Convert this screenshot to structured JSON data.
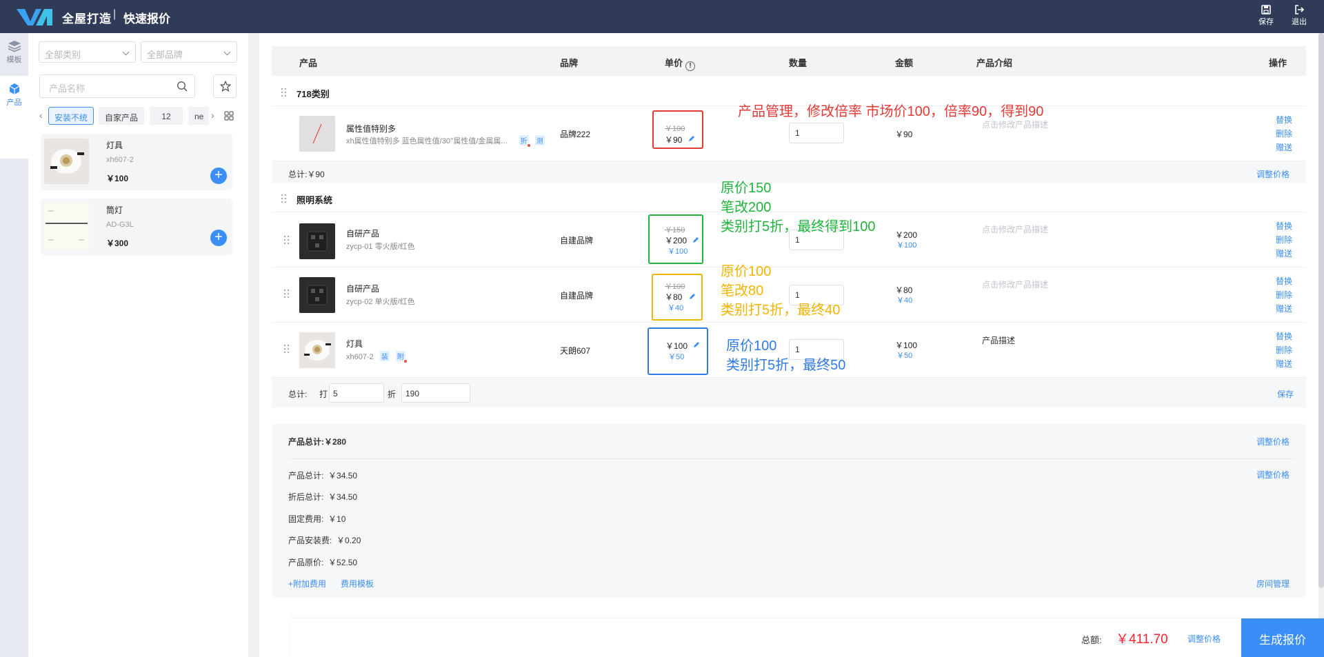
{
  "header": {
    "title": "全屋打造",
    "separator": "|",
    "subtitle": "快速报价",
    "save_label": "保存",
    "exit_label": "退出"
  },
  "leftnav": {
    "items": [
      {
        "label": "模板",
        "icon": "layers-icon"
      },
      {
        "label": "产品",
        "icon": "cube-icon"
      }
    ]
  },
  "sidebar": {
    "category_select": "全部类别",
    "brand_select": "全部品牌",
    "search_placeholder": "产品名称",
    "chips": [
      "安装不统",
      "自家产品",
      "12",
      "ne"
    ],
    "products": [
      {
        "name": "灯具",
        "code": "xh607-2",
        "price": "￥100"
      },
      {
        "name": "筒灯",
        "code": "AD-G3L",
        "price": "￥300"
      }
    ]
  },
  "table": {
    "columns": {
      "product": "产品",
      "brand": "品牌",
      "unit_price": "单价",
      "quantity": "数量",
      "amount": "金额",
      "description": "产品介绍",
      "actions": "操作"
    },
    "row_actions": {
      "replace": "替换",
      "delete": "删除",
      "gift": "赠送"
    },
    "groups": [
      {
        "name": "718类别",
        "items": [
          {
            "name": "属性值特别多",
            "spec": "xh属性值特别多 蓝色属性值/30°属性值/金属属...",
            "tags": [
              "折",
              "测"
            ],
            "brand": "品牌222",
            "old_price": "￥100",
            "price": "￥90",
            "qty": "1",
            "amount": "￥90",
            "desc": "点击修改产品描述"
          }
        ],
        "subtotal_label": "总计:",
        "subtotal_value": "￥90",
        "subtotal_link": "调整价格"
      },
      {
        "name": "照明系统",
        "items": [
          {
            "name": "自研产品",
            "spec": "zycp-01 零火版/红色",
            "brand": "自建品牌",
            "old_price": "￥150",
            "price": "￥200",
            "disc_price": "￥100",
            "qty": "1",
            "amount": "￥200",
            "amount_disc": "￥100",
            "desc": "点击修改产品描述"
          },
          {
            "name": "自研产品",
            "spec": "zycp-02 单火版/红色",
            "brand": "自建品牌",
            "old_price": "￥100",
            "price": "￥80",
            "disc_price": "￥40",
            "qty": "1",
            "amount": "￥80",
            "amount_disc": "￥40",
            "desc": "点击修改产品描述"
          },
          {
            "name": "灯具",
            "spec": "xh607-2",
            "tags": [
              "装",
              "附"
            ],
            "brand": "天朗607",
            "price": "￥100",
            "disc_price": "￥50",
            "qty": "1",
            "amount": "￥100",
            "amount_disc": "￥50",
            "desc": "产品描述"
          }
        ],
        "subtotal_label": "总计:",
        "discount_prefix": "打",
        "discount_value": "5",
        "discount_suffix": "折",
        "discount_total": "190",
        "subtotal_link": "保存"
      }
    ]
  },
  "summary": {
    "product_total_label": "产品总计:",
    "product_total_value": "￥280",
    "adjust_link": "调整价格",
    "adjust_link_2": "调整价格",
    "lines": [
      {
        "label": "产品总计:",
        "value": "￥34.50"
      },
      {
        "label": "折后总计:",
        "value": "￥34.50"
      },
      {
        "label": "固定费用:",
        "value": "￥10"
      },
      {
        "label": "产品安装费:",
        "value": "￥0.20"
      },
      {
        "label": "产品原价:",
        "value": "￥52.50"
      }
    ],
    "add_fee_link": "+附加费用",
    "fee_template_link": "费用模板",
    "room_manage_link": "房间管理"
  },
  "footer": {
    "total_label": "总额:",
    "total_value": "￥411.70",
    "adjust_link": "调整价格",
    "generate_button": "生成报价"
  },
  "annotations": {
    "red": "产品管理，修改倍率  市场价100，倍率90，得到90",
    "green": [
      "原价150",
      "笔改200",
      "类别打5折，最终得到100"
    ],
    "orange": [
      "原价100",
      "笔改80",
      "类别打5折，最终40"
    ],
    "blue": [
      "原价100",
      "类别打5折，最终50"
    ]
  },
  "colors": {
    "topbar": "#2f3b57",
    "accent": "#3a8ef6",
    "annotation_red": "#e53935",
    "annotation_green": "#1fb53c",
    "annotation_orange": "#f5b400",
    "annotation_blue": "#2e7be6",
    "total_red": "#f5222d"
  }
}
